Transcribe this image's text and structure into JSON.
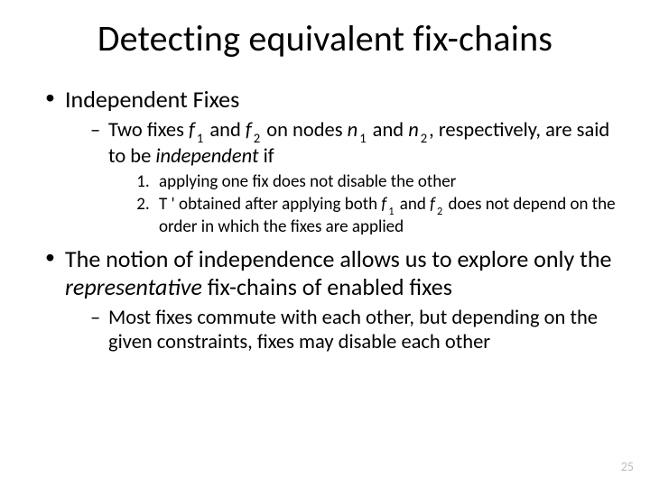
{
  "title": "Detecting equivalent fix-chains",
  "bullets": {
    "b1": {
      "label": "Independent Fixes",
      "sub1": {
        "pre": "Two fixes ",
        "f": "f",
        "s1": "1",
        "and1": " and ",
        "s2": "2",
        "mid": " on nodes ",
        "n": "n",
        "ns1": "1",
        "and2": " and ",
        "ns2": "2",
        "post": ", respectively, are said to be ",
        "indep": "independent",
        "tail": " if"
      },
      "ol": {
        "i1": "applying one fix does not disable the other",
        "i2": {
          "pre": "T ' obtained after applying both ",
          "f": "f",
          "s1": "1",
          "and": " and ",
          "s2": "2",
          "post": "  does not depend on the order in which the fixes are applied"
        }
      }
    },
    "b2": {
      "pre": "The notion of independence allows us to explore only the ",
      "rep": "representative",
      "post": " fix-chains of enabled fixes",
      "sub1": "Most fixes commute with each other, but depending on the given constraints, fixes may disable each other"
    }
  },
  "pagenum": "25"
}
